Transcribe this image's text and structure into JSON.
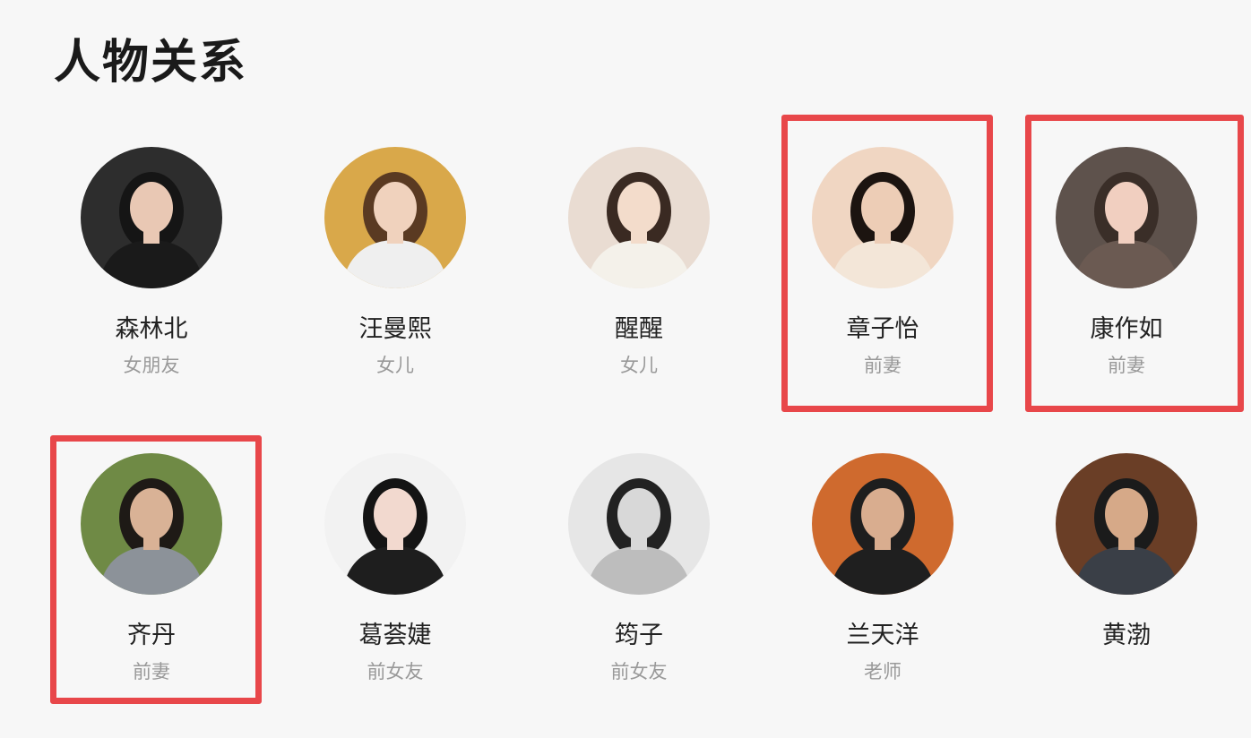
{
  "page": {
    "title": "人物关系"
  },
  "people": [
    {
      "name": "森林北",
      "relation": "女朋友",
      "highlighted": false,
      "bg": "#2d2d2d",
      "hair": "#151515",
      "skin": "#e9c8b4",
      "clothes": "#1a1a1a"
    },
    {
      "name": "汪曼熙",
      "relation": "女儿",
      "highlighted": false,
      "bg": "#d9a84a",
      "hair": "#5a3a22",
      "skin": "#f0d2bd",
      "clothes": "#efefef"
    },
    {
      "name": "醒醒",
      "relation": "女儿",
      "highlighted": false,
      "bg": "#e9dcd2",
      "hair": "#3a2a22",
      "skin": "#f3dccb",
      "clothes": "#f4f1ea"
    },
    {
      "name": "章子怡",
      "relation": "前妻",
      "highlighted": true,
      "bg": "#f0d6c2",
      "hair": "#1c1410",
      "skin": "#edcdb6",
      "clothes": "#f3e6d8"
    },
    {
      "name": "康作如",
      "relation": "前妻",
      "highlighted": true,
      "bg": "#5e524c",
      "hair": "#3a2e28",
      "skin": "#f1cfc0",
      "clothes": "#6b5a52"
    },
    {
      "name": "齐丹",
      "relation": "前妻",
      "highlighted": true,
      "bg": "#6f8a45",
      "hair": "#1e1a16",
      "skin": "#d9b296",
      "clothes": "#8c9299"
    },
    {
      "name": "葛荟婕",
      "relation": "前女友",
      "highlighted": false,
      "bg": "#f2f2f2",
      "hair": "#141414",
      "skin": "#f2d9cf",
      "clothes": "#1e1e1e"
    },
    {
      "name": "筠子",
      "relation": "前女友",
      "highlighted": false,
      "bg": "#e6e6e6",
      "hair": "#222222",
      "skin": "#d8d8d8",
      "clothes": "#bdbdbd"
    },
    {
      "name": "兰天洋",
      "relation": "老师",
      "highlighted": false,
      "bg": "#cf6a2e",
      "hair": "#1e1e1e",
      "skin": "#d9ad8f",
      "clothes": "#1f1f1f"
    },
    {
      "name": "黄渤",
      "relation": "",
      "highlighted": false,
      "bg": "#6a3e26",
      "hair": "#1b1b1b",
      "skin": "#d6a988",
      "clothes": "#3a3f47"
    }
  ],
  "colors": {
    "highlight": "#e8474a",
    "name_text": "#222222",
    "relation_text": "#999999"
  }
}
